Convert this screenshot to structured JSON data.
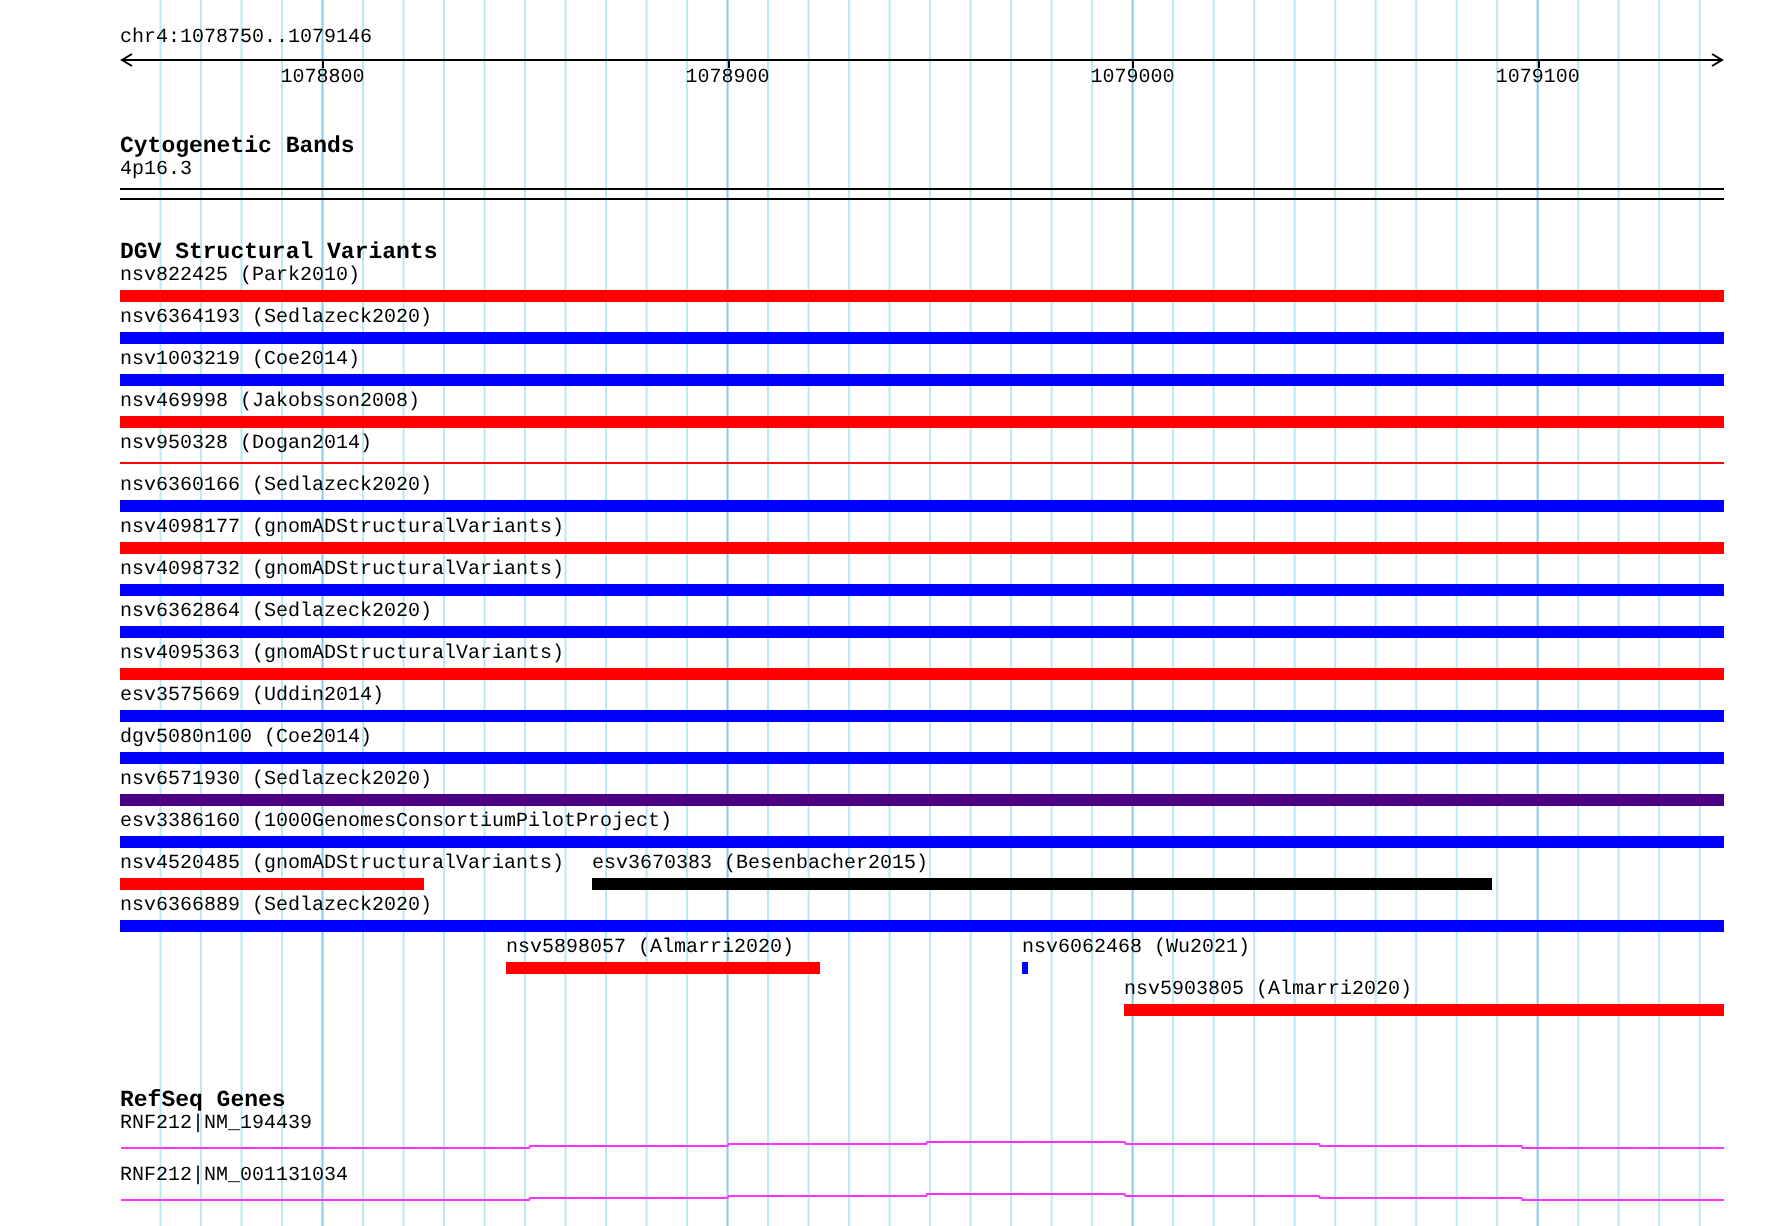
{
  "ruler": {
    "location": "chr4:1078750..1079146",
    "ticks": [
      "1078800",
      "1078900",
      "1079000",
      "1079100"
    ]
  },
  "cytogenetic_bands": {
    "title": "Cytogenetic Bands",
    "band": "4p16.3"
  },
  "dgv_structural_variants": {
    "title": "DGV Structural Variants",
    "rows": [
      [
        {
          "label": "nsv822425 (Park2010)",
          "color": "#ff0000",
          "kind": "thick"
        }
      ],
      [
        {
          "label": "nsv6364193 (Sedlazeck2020)",
          "color": "#0000ff",
          "kind": "thick"
        }
      ],
      [
        {
          "label": "nsv1003219 (Coe2014)",
          "color": "#0000ff",
          "kind": "thick"
        }
      ],
      [
        {
          "label": "nsv469998 (Jakobsson2008)",
          "color": "#ff0000",
          "kind": "thick"
        }
      ],
      [
        {
          "label": "nsv950328 (Dogan2014)",
          "color": "#ff0000",
          "kind": "thin"
        }
      ],
      [
        {
          "label": "nsv6360166 (Sedlazeck2020)",
          "color": "#0000ff",
          "kind": "thick"
        }
      ],
      [
        {
          "label": "nsv4098177 (gnomADStructuralVariants)",
          "color": "#ff0000",
          "kind": "thick"
        }
      ],
      [
        {
          "label": "nsv4098732 (gnomADStructuralVariants)",
          "color": "#0000ff",
          "kind": "thick"
        }
      ],
      [
        {
          "label": "nsv6362864 (Sedlazeck2020)",
          "color": "#0000ff",
          "kind": "thick"
        }
      ],
      [
        {
          "label": "nsv4095363 (gnomADStructuralVariants)",
          "color": "#ff0000",
          "kind": "thick"
        }
      ],
      [
        {
          "label": "esv3575669 (Uddin2014)",
          "color": "#0000ff",
          "kind": "thick"
        }
      ],
      [
        {
          "label": "dgv5080n100 (Coe2014)",
          "color": "#0000ff",
          "kind": "thick"
        }
      ],
      [
        {
          "label": "nsv6571930 (Sedlazeck2020)",
          "color": "#4b0082",
          "kind": "thick"
        }
      ],
      [
        {
          "label": "esv3386160 (1000GenomesConsortiumPilotProject)",
          "color": "#0000ff",
          "kind": "thick"
        }
      ],
      [
        {
          "label": "nsv4520485 (gnomADStructuralVariants)",
          "color": "#ff0000",
          "kind": "thick"
        },
        {
          "label": "esv3670383 (Besenbacher2015)",
          "color": "#000000",
          "kind": "thick"
        }
      ],
      [
        {
          "label": "nsv6366889 (Sedlazeck2020)",
          "color": "#0000ff",
          "kind": "thick"
        }
      ],
      [
        {
          "label": "nsv5898057 (Almarri2020)",
          "color": "#ff0000",
          "kind": "thick"
        },
        {
          "label": "nsv6062468 (Wu2021)",
          "color": "#0000ff",
          "kind": "thick"
        }
      ],
      [
        {
          "label": "nsv5903805 (Almarri2020)",
          "color": "#ff0000",
          "kind": "thick"
        }
      ]
    ]
  },
  "refseq_genes": {
    "title": "RefSeq Genes",
    "genes": [
      {
        "label": "RNF212|NM_194439"
      },
      {
        "label": "RNF212|NM_001131034"
      }
    ]
  }
}
